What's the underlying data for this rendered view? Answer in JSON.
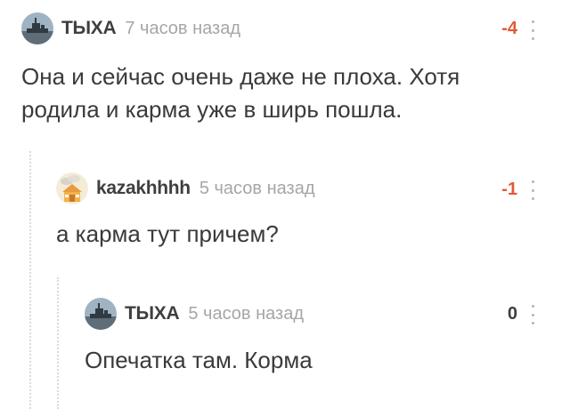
{
  "comments": [
    {
      "username": "ТЫХА",
      "time": "7 часов назад",
      "rating": "-4",
      "text": "Она и сейчас очень даже не плоха. Хотя родила и карма уже в ширь пошла.",
      "avatar": "ship-photo-avatar"
    },
    {
      "username": "kazakhhhh",
      "time": "5 часов назад",
      "rating": "-1",
      "text": "а карма тут причем?",
      "avatar": "house-avatar"
    },
    {
      "username": "ТЫХА",
      "time": "5 часов назад",
      "rating": "0",
      "text": "Опечатка там. Корма",
      "avatar": "ship-photo-avatar"
    }
  ],
  "icons": {
    "menu": "more-vertical-icon"
  },
  "colors": {
    "negative_rating": "#e05a3a",
    "zero_rating": "#3f3f3f",
    "username": "#3f3f3f",
    "time": "#a6a6a6",
    "text": "#3a3a3a"
  }
}
